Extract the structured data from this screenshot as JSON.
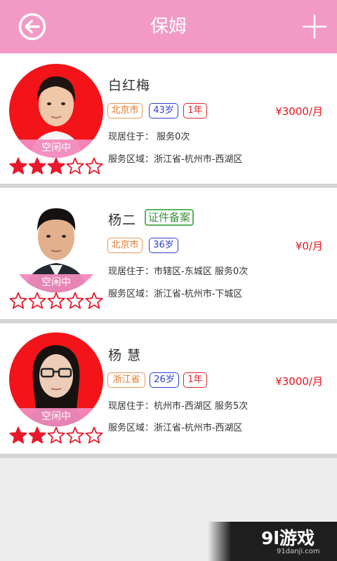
{
  "header": {
    "title": "保姆",
    "back_icon": "back-arrow-icon",
    "add_icon": "plus-icon",
    "background": "#f29ac5"
  },
  "caregivers": [
    {
      "name": "白红梅",
      "status": "空闲中",
      "city": "北京市",
      "age": "43岁",
      "experience": "1年",
      "price": "¥3000/月",
      "residence": "现居住于：  服务0次",
      "service_area": "服务区域：浙江省-杭州市-西湖区",
      "rating": 3,
      "certified_label": ""
    },
    {
      "name": "杨二",
      "status": "空闲中",
      "city": "北京市",
      "age": "36岁",
      "experience": "",
      "price": "¥0/月",
      "residence": "现居住于：市辖区-东城区  服务0次",
      "service_area": "服务区域：浙江省-杭州市-下城区",
      "rating": 0,
      "certified_label": "证件备案"
    },
    {
      "name": "杨 慧",
      "status": "空闲中",
      "city": "浙江省",
      "age": "26岁",
      "experience": "1年",
      "price": "¥3000/月",
      "residence": "现居住于：杭州市-西湖区  服务5次",
      "service_area": "服务区域：浙江省-杭州市-西湖区",
      "rating": 2,
      "certified_label": ""
    }
  ],
  "colors": {
    "star": "#e8192c",
    "price": "#e3161e",
    "status_bar": "#f38abe"
  },
  "watermark": {
    "logo": "9l游戏",
    "url": "91danji.com"
  }
}
